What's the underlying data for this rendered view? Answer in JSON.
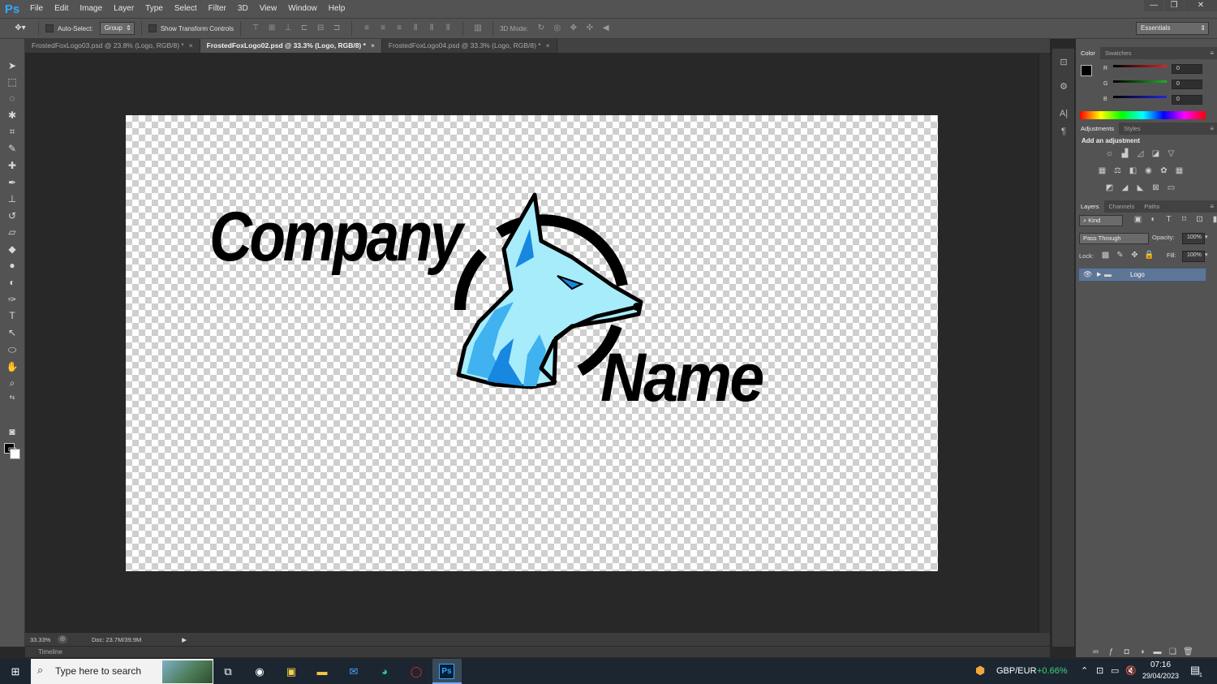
{
  "app": {
    "logo": "Ps"
  },
  "menu": [
    "File",
    "Edit",
    "Image",
    "Layer",
    "Type",
    "Select",
    "Filter",
    "3D",
    "View",
    "Window",
    "Help"
  ],
  "window_controls": [
    "—",
    "❐",
    "✕"
  ],
  "options": {
    "auto_select_label": "Auto-Select:",
    "auto_select_value": "Group",
    "show_transform_label": "Show Transform Controls",
    "mode_3d_label": "3D Mode:",
    "workspace": "Essentials"
  },
  "tabs": [
    {
      "label": "FrostedFoxLogo03.psd @ 23.8% (Logo, RGB/8) *",
      "close": "×",
      "active": false
    },
    {
      "label": "FrostedFoxLogo02.psd @ 33.3% (Logo, RGB/8) *",
      "close": "×",
      "active": true
    },
    {
      "label": "FrostedFoxLogo04.psd @ 33.3% (Logo, RGB/8) *",
      "close": "×",
      "active": false
    }
  ],
  "artwork": {
    "word1": "Company",
    "word2": "Name",
    "fox_colors": {
      "light": "#a7ecfb",
      "mid": "#3fb2ef",
      "dark": "#1787e0",
      "outline": "#000000"
    }
  },
  "status": {
    "zoom": "33.33%",
    "doc": "Doc: 23.7M/39.9M"
  },
  "timeline": {
    "label": "Timeline"
  },
  "color_panel": {
    "tabs": [
      "Color",
      "Swatches"
    ],
    "channels": [
      {
        "label": "R",
        "value": "0",
        "color": "#e02424"
      },
      {
        "label": "G",
        "value": "0",
        "color": "#21b021"
      },
      {
        "label": "B",
        "value": "0",
        "color": "#2424e0"
      }
    ]
  },
  "adjustments_panel": {
    "tabs": [
      "Adjustments",
      "Styles"
    ],
    "heading": "Add an adjustment"
  },
  "layers_panel": {
    "tabs": [
      "Layers",
      "Channels",
      "Paths"
    ],
    "filter_kind": "Kind",
    "blend_mode": "Pass Through",
    "opacity_label": "Opacity:",
    "opacity_value": "100%",
    "lock_label": "Lock:",
    "fill_label": "Fill:",
    "fill_value": "100%",
    "layers": [
      {
        "name": "Logo",
        "type": "group",
        "visible": true,
        "selected": true
      }
    ]
  },
  "taskbar": {
    "search_placeholder": "Type here to search",
    "ticker_label": "GBP/EUR",
    "ticker_change": "+0.66%",
    "time": "07:16",
    "date": "29/04/2023",
    "notification_count": "1"
  }
}
